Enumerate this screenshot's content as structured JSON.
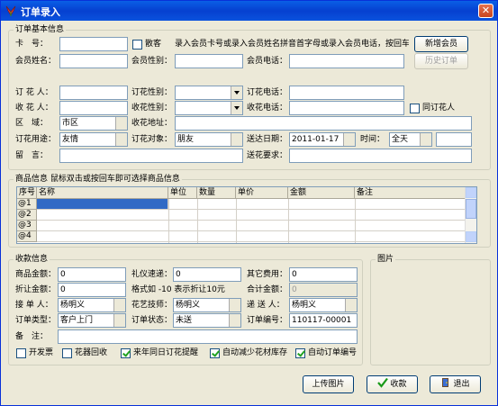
{
  "window": {
    "title": "订单录入",
    "close": "✕"
  },
  "basic": {
    "legend": "订单基本信息",
    "card_no_label": "卡　号：",
    "card_no_value": "",
    "retail_label": "散客",
    "hint": "录入会员卡号或录入会员姓名拼音首字母或录入会员电话，按回车...",
    "member_name_label": "会员姓名：",
    "member_gender_label": "会员性别：",
    "member_phone_label": "会员电话：",
    "new_member": "新增会员",
    "history_orders": "历史订单",
    "orderer_label": "订 花 人：",
    "orderer_gender_label": "订花性别：",
    "orderer_phone_label": "订花电话：",
    "receiver_label": "收 花 人：",
    "receiver_gender_label": "收花性别：",
    "receiver_phone_label": "收花电话：",
    "same_as_orderer": "同订花人",
    "area_label": "区　域：",
    "area_value": "市区",
    "address_label": "收花地址：",
    "purpose_label": "订花用途：",
    "purpose_value": "友情",
    "target_label": "订花对象：",
    "target_value": "朋友",
    "date_label": "送达日期：",
    "date_value": "2011-01-17",
    "time_label": "时间：",
    "time_value": "全天",
    "message_label": "留　言：",
    "requirement_label": "送花要求："
  },
  "goods": {
    "legend": "商品信息 鼠标双击或按回车即可选择商品信息",
    "columns": [
      "序号",
      "名称",
      "单位",
      "数量",
      "单价",
      "金额",
      "备注"
    ],
    "rows": [
      "@1",
      "@2",
      "@3",
      "@4"
    ]
  },
  "payment": {
    "legend": "收款信息",
    "goods_amount_label": "商品金额：",
    "goods_amount": "0",
    "gift_fee_label": "礼仪速递：",
    "gift_fee": "0",
    "other_fee_label": "其它费用：",
    "other_fee": "0",
    "discount_label": "折让金额：",
    "discount": "0",
    "discount_hint": "格式如 -10 表示折让10元",
    "total_label": "合计金额：",
    "total": "0",
    "receptionist_label": "接 单 人：",
    "receptionist": "杨明义",
    "florist_label": "花艺技师：",
    "florist": "杨明义",
    "deliverer_label": "递 送 人：",
    "deliverer": "杨明义",
    "order_type_label": "订单类型：",
    "order_type": "客户上门",
    "order_status_label": "订单状态：",
    "order_status": "未送",
    "order_no_label": "订单编号：",
    "order_no": "110117-00001",
    "remark_label": "备　注：",
    "invoice": "开发票",
    "recycle": "花器回收",
    "reminder": "来年同日订花提醒",
    "reduce_stock": "自动减少花材库存",
    "auto_number": "自动订单编号"
  },
  "picture": {
    "legend": "图片"
  },
  "footer": {
    "upload": "上传图片",
    "collect": "收款",
    "exit": "退出"
  }
}
